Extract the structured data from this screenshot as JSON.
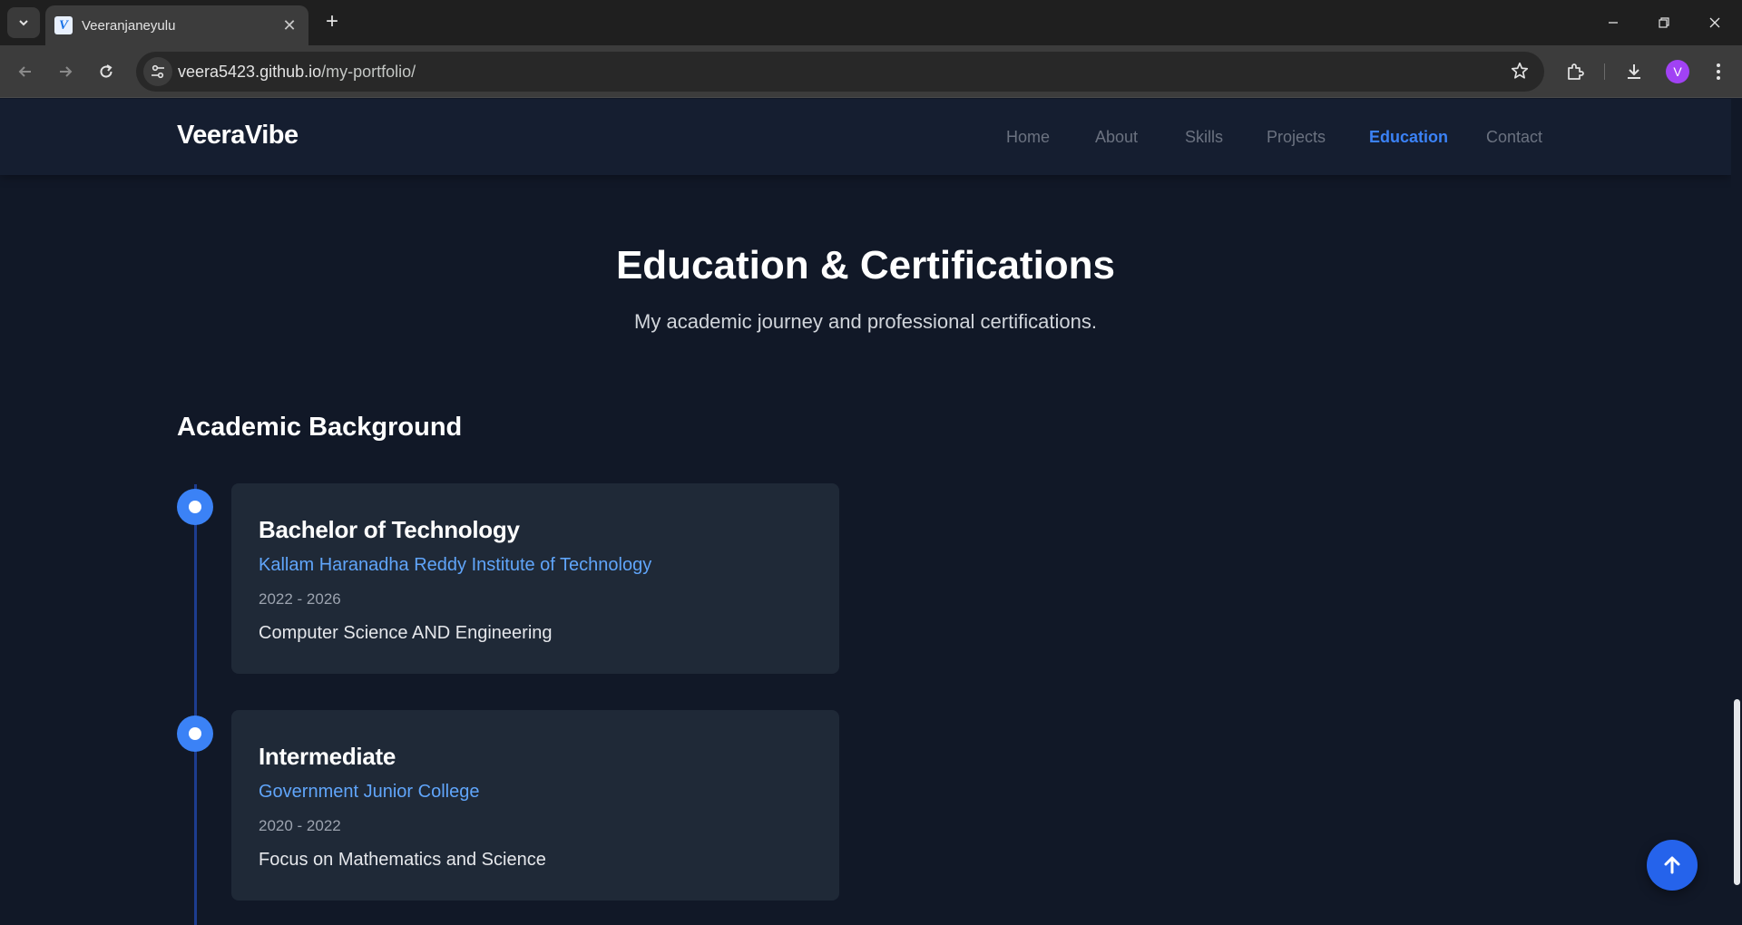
{
  "browser": {
    "tab_title": "Veeranjaneyulu",
    "favicon_letter": "V",
    "url_host": "veera5423.github.io",
    "url_path": "/my-portfolio/",
    "profile_initial": "V"
  },
  "site": {
    "brand": "VeeraVibe",
    "nav": [
      "Home",
      "About",
      "Skills",
      "Projects",
      "Education",
      "Contact"
    ],
    "active_nav": "Education"
  },
  "section": {
    "title": "Education & Certifications",
    "subtitle": "My academic journey and professional certifications.",
    "academic_heading": "Academic Background"
  },
  "education": [
    {
      "degree": "Bachelor of Technology",
      "institution": "Kallam Haranadha Reddy Institute of Technology",
      "years": "2022 - 2026",
      "description": "Computer Science AND Engineering"
    },
    {
      "degree": "Intermediate",
      "institution": "Government Junior College",
      "years": "2020 - 2022",
      "description": "Focus on Mathematics and Science"
    }
  ],
  "colors": {
    "accent": "#3b82f6",
    "background": "#111827",
    "card": "#1f2937"
  }
}
